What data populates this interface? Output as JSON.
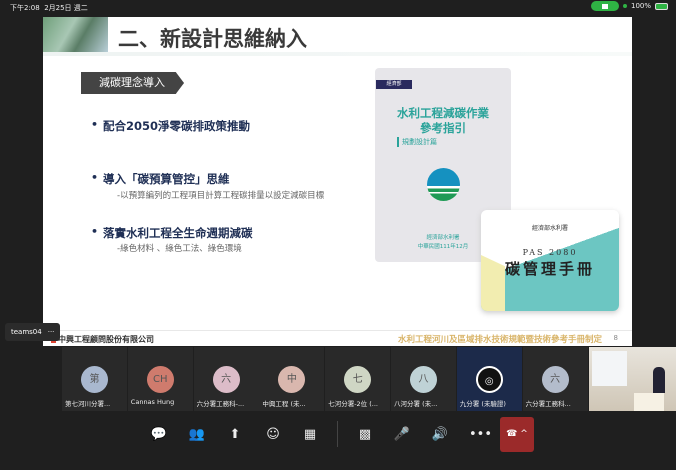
{
  "status_bar": {
    "time": "下午2:08",
    "date": "2月25日 週二",
    "battery": "100%"
  },
  "slide": {
    "title": "二、新設計思維納入",
    "tag": "減碳理念導入",
    "bullets": [
      {
        "text": "配合2050淨零碳排政策推動",
        "sub": ""
      },
      {
        "text": "導入「碳預算管控」思維",
        "sub": "-以預算編列的工程項目計算工程碳排量以設定減碳目標"
      },
      {
        "text": "落實水利工程全生命週期減碳",
        "sub": "-綠色材料 、綠色工法、綠色環境"
      }
    ],
    "book1": {
      "publisher_tag": "經濟部",
      "title_line1": "水利工程減碳作業",
      "title_line2": "參考指引",
      "subtitle": "規劃設計篇",
      "footer_line1": "經濟部水利署",
      "footer_line2": "中華民國111年12月"
    },
    "book2": {
      "publisher": "經濟部水利署",
      "line1": "PAS 2080",
      "title": "碳管理手冊"
    },
    "footer_company": "中興工程顧問股份有限公司",
    "footer_title": "水利工程河川及區域排水技術規範暨技術參考手冊制定",
    "page_number": "8"
  },
  "presenter_label": "teams04",
  "presenter_more": "···",
  "participants": [
    {
      "initial": "第",
      "name": "第七河川分署...",
      "color": "#a9b8cf"
    },
    {
      "initial": "CH",
      "name": "Cannas Hung",
      "color": "#cf7b6d"
    },
    {
      "initial": "六",
      "name": "六分署工務科-...",
      "color": "#dcbcc8"
    },
    {
      "initial": "中",
      "name": "中興工程 (未...",
      "color": "#d9b7ae"
    },
    {
      "initial": "七",
      "name": "七河分署-2位 (...",
      "color": "#cfd6c4"
    },
    {
      "initial": "八",
      "name": "八河分署 (未...",
      "color": "#bfd2d6"
    },
    {
      "initial": "",
      "name": "九分署 (未驗證)",
      "color": "#111"
    },
    {
      "initial": "六",
      "name": "六分署工務科...",
      "color": "#b3bccb"
    }
  ],
  "toolbar": [
    "chat-icon",
    "people-icon",
    "share-icon",
    "react-icon",
    "apps-icon",
    "camera-icon",
    "mic-icon",
    "speaker-icon",
    "more-icon"
  ],
  "end_call": "^",
  "colors": {
    "end_call": "#9b2a2a",
    "accent_teal": "#2aa39a",
    "slide_heading": "#1f2f55"
  }
}
